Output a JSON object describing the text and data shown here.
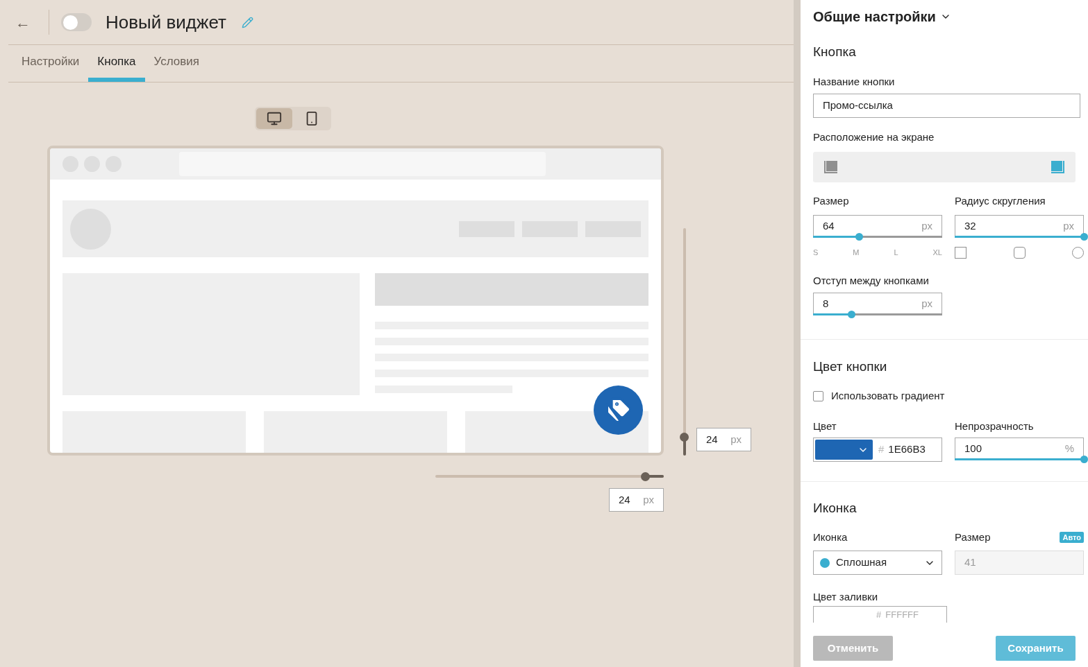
{
  "header": {
    "back": "←",
    "title": "Новый виджет",
    "enabled": false
  },
  "tabs": [
    {
      "label": "Настройки",
      "selected": false
    },
    {
      "label": "Кнопка",
      "selected": true
    },
    {
      "label": "Условия",
      "selected": false
    }
  ],
  "devices": [
    {
      "kind": "desktop",
      "selected": true
    },
    {
      "kind": "mobile",
      "selected": false
    }
  ],
  "preview": {
    "vertical_offset": {
      "value": "24",
      "unit": "px",
      "level": 0.08
    },
    "horizontal_offset": {
      "value": "24",
      "unit": "px",
      "level": 0.08
    }
  },
  "panel": {
    "title": "Общие настройки",
    "button": {
      "heading": "Кнопка",
      "name_label": "Название кнопки",
      "name_value": "Промо-ссылка",
      "position_label": "Расположение на экране",
      "positions": [
        {
          "kind": "left",
          "selected": false
        },
        {
          "kind": "right",
          "selected": true
        }
      ],
      "size": {
        "label": "Размер",
        "value": "64",
        "unit": "px",
        "level": 0.36,
        "marks": [
          "S",
          "M",
          "L",
          "XL"
        ]
      },
      "radius": {
        "label": "Радиус скругления",
        "value": "32",
        "unit": "px",
        "level": 1,
        "shapes": [
          {
            "kind": "square"
          },
          {
            "kind": "rounded"
          },
          {
            "kind": "circle"
          }
        ]
      },
      "gap": {
        "label": "Отступ между кнопками",
        "value": "8",
        "unit": "px",
        "level": 0.3
      }
    },
    "color": {
      "heading": "Цвет кнопки",
      "gradient": {
        "label": "Использовать градиент",
        "checked": false
      },
      "color_label": "Цвет",
      "hash": "#",
      "hex": "1E66B3",
      "opacity": {
        "label": "Непрозрачность",
        "value": "100",
        "unit": "%",
        "level": 1
      }
    },
    "icon": {
      "heading": "Иконка",
      "icon_label": "Иконка",
      "icon_value": "Сплошная",
      "size_label": "Размер",
      "auto_badge": "Авто",
      "size_value": "41",
      "fill_label": "Цвет заливки",
      "fill_hash": "#",
      "fill_hex": "FFFFFF"
    },
    "actions": {
      "cancel": "Отменить",
      "save": "Сохранить"
    }
  }
}
